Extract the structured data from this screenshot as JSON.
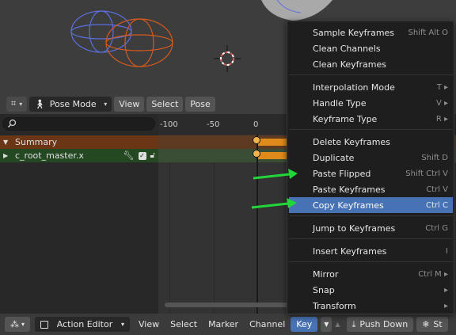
{
  "viewport_header": {
    "mode": "Pose Mode",
    "view": "View",
    "select": "Select",
    "pose": "Pose"
  },
  "channels": {
    "summary": "Summary",
    "root": "c_root_master.x"
  },
  "ruler": [
    "-100",
    "-50",
    "0"
  ],
  "menu": {
    "items": [
      {
        "label": "Sample Keyframes",
        "shortcut": "Shift Alt O"
      },
      {
        "label": "Clean Channels",
        "shortcut": ""
      },
      {
        "label": "Clean Keyframes",
        "shortcut": ""
      },
      {
        "label": "Interpolation Mode",
        "shortcut": "T ▸"
      },
      {
        "label": "Handle Type",
        "shortcut": "V ▸"
      },
      {
        "label": "Keyframe Type",
        "shortcut": "R ▸"
      },
      {
        "label": "Delete Keyframes",
        "shortcut": ""
      },
      {
        "label": "Duplicate",
        "shortcut": "Shift D"
      },
      {
        "label": "Paste Flipped",
        "shortcut": "Shift Ctrl V"
      },
      {
        "label": "Paste Keyframes",
        "shortcut": "Ctrl V"
      },
      {
        "label": "Copy Keyframes",
        "shortcut": "Ctrl C"
      },
      {
        "label": "Jump to Keyframes",
        "shortcut": "Ctrl G"
      },
      {
        "label": "Insert Keyframes",
        "shortcut": "I"
      },
      {
        "label": "Mirror",
        "shortcut": "Ctrl M ▸"
      },
      {
        "label": "Snap",
        "shortcut": "▸"
      },
      {
        "label": "Transform",
        "shortcut": "▸"
      }
    ]
  },
  "bottom_bar": {
    "editor": "Action Editor",
    "view": "View",
    "select": "Select",
    "marker": "Marker",
    "channel": "Channel",
    "key": "Key",
    "push_down": "Push Down",
    "stash_partial": "St"
  },
  "colors": {
    "accent": "#4772b3",
    "summary_row": "#6b3615",
    "root_row": "#244822",
    "keyframe": "#f2b44a",
    "arrow": "#22d63a"
  },
  "icons": {
    "search": "search-icon",
    "wrench": "wrench-icon",
    "checkbox": "checkbox-icon",
    "lock": "lock-icon"
  }
}
